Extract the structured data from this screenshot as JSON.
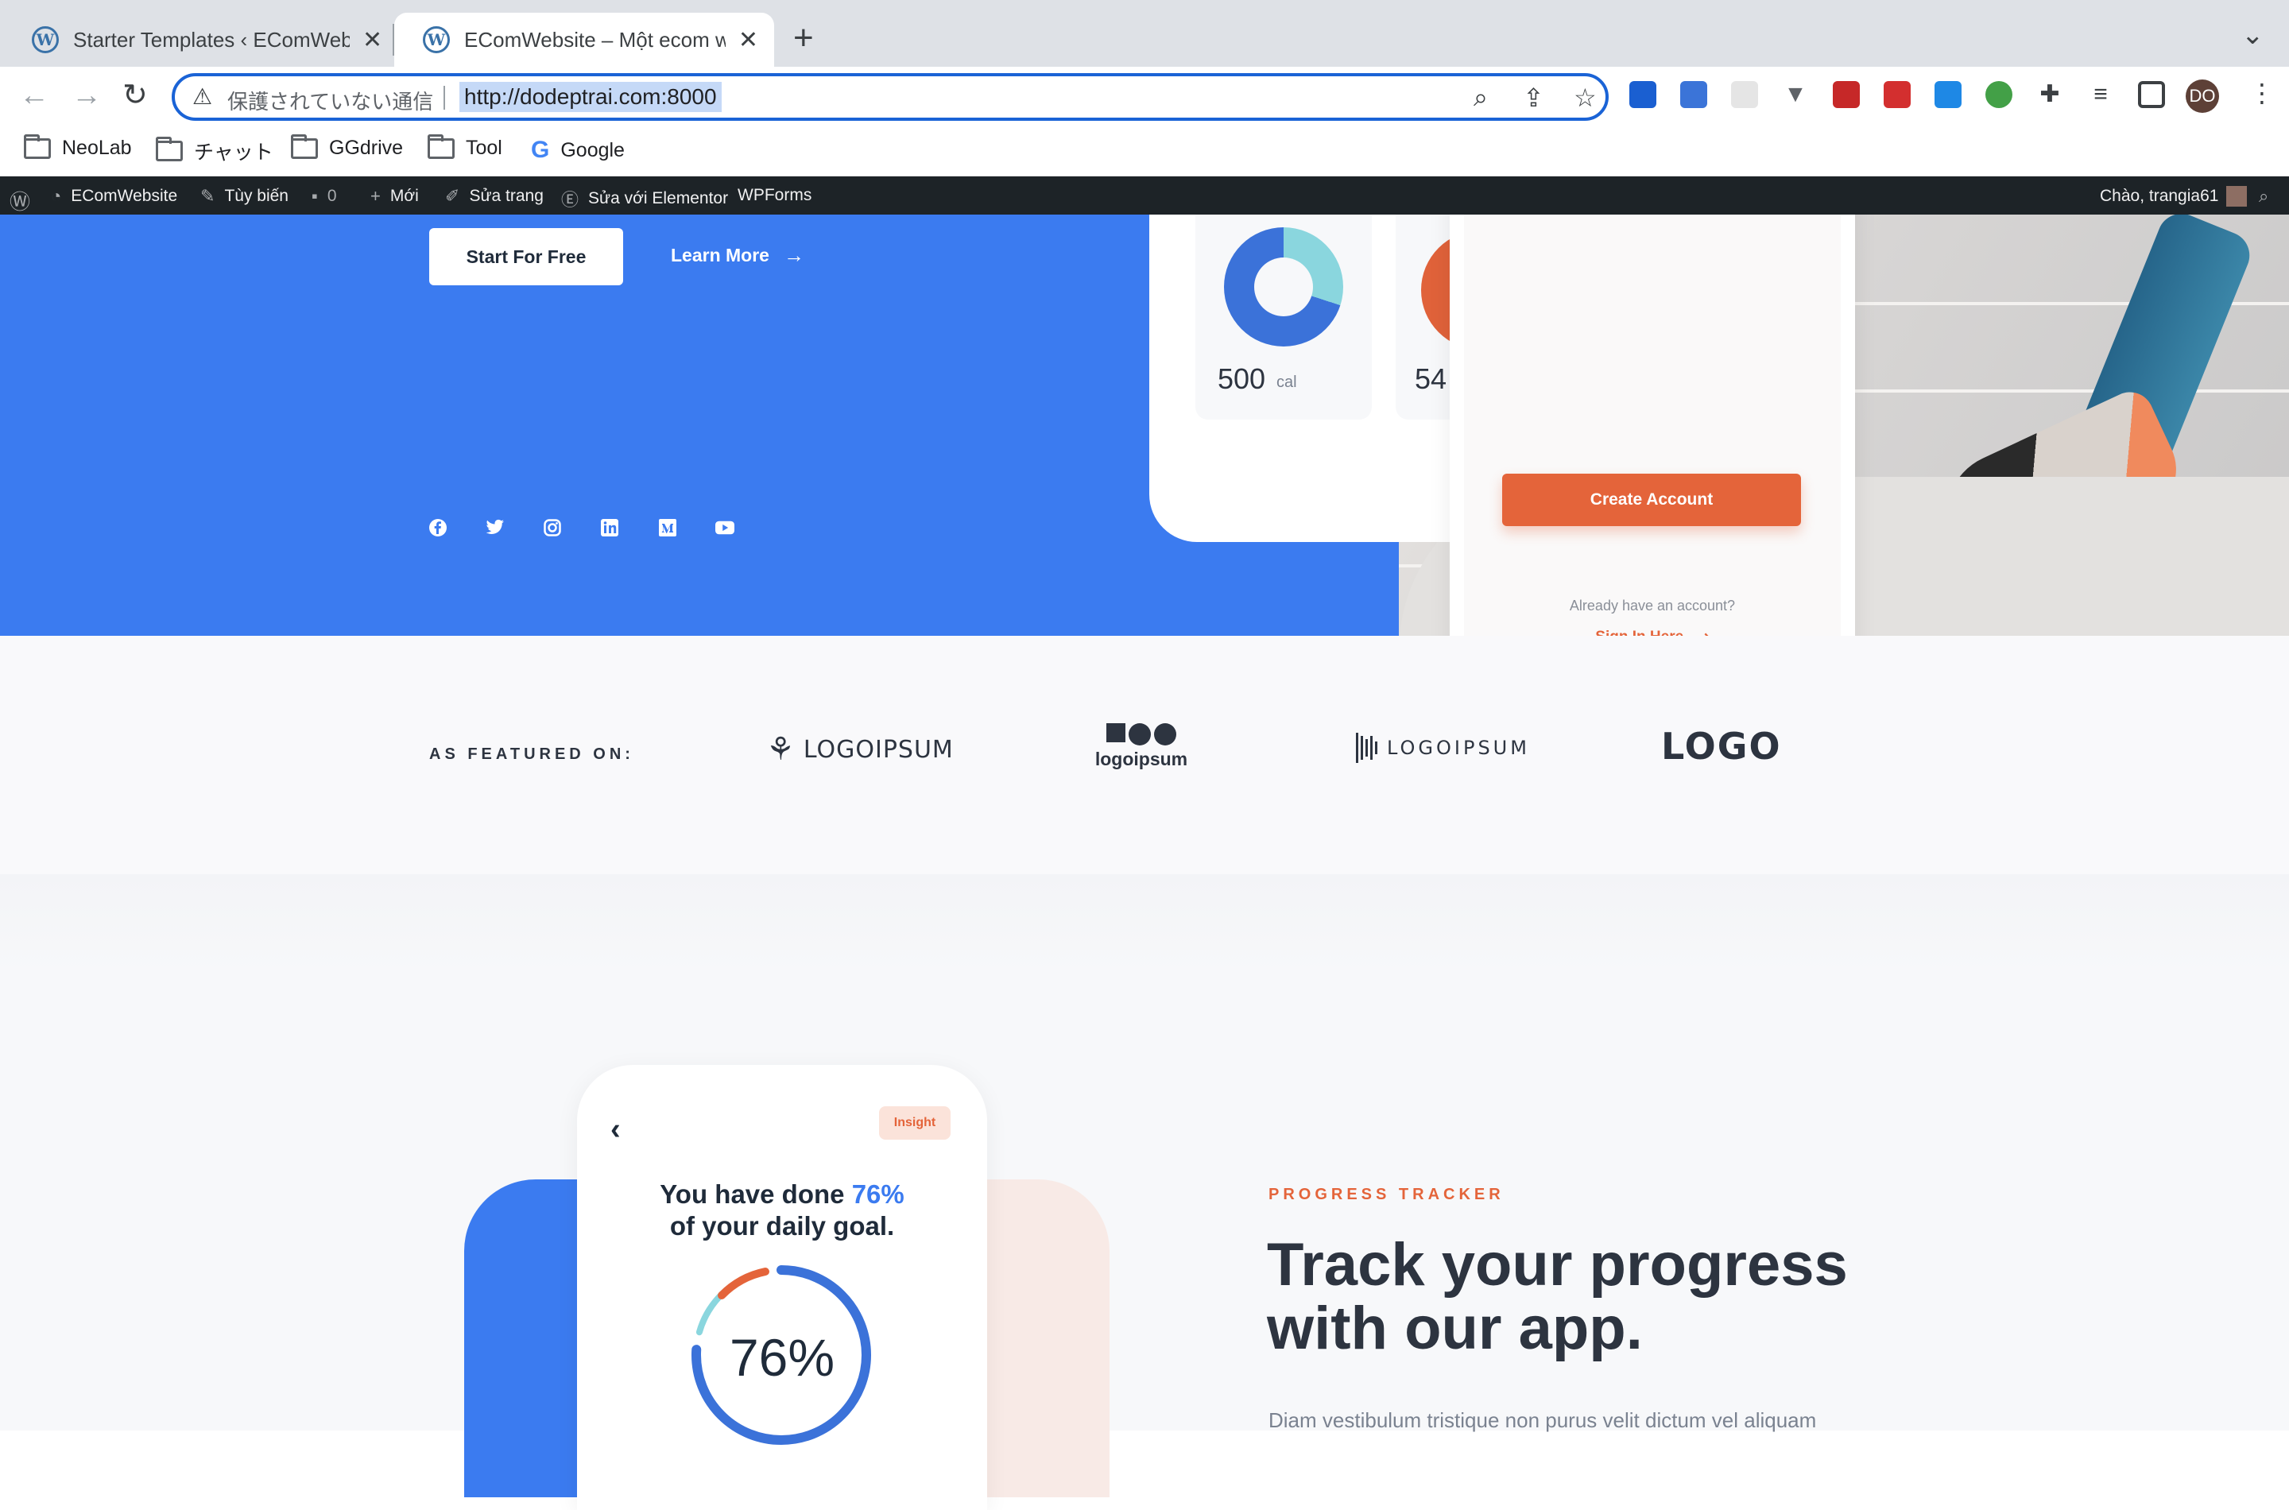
{
  "browser": {
    "tabs": [
      {
        "title": "Starter Templates ‹ EComWebsite",
        "active": false
      },
      {
        "title": "EComWebsite – Một ecom website",
        "active": true
      }
    ],
    "security_label": "保護されていない通信",
    "url": "http://dodeptrai.com:8000",
    "bookmarks": [
      "NeoLab",
      "チャット",
      "GGdrive",
      "Tool",
      "Google"
    ],
    "profile_initials": "DO"
  },
  "admin_bar": {
    "site_name": "EComWebsite",
    "customize": "Tùy biến",
    "comments_count": "0",
    "new": "Mới",
    "edit_page": "Sửa trang",
    "edit_elementor": "Sửa với Elementor",
    "wpforms": "WPForms",
    "greeting": "Chào, trangia61"
  },
  "hero": {
    "start_button": "Start For Free",
    "learn_more": "Learn More",
    "calorie_value": "500",
    "calorie_unit": "cal",
    "second_value": "54",
    "create_account": "Create Account",
    "already_account": "Already have an account?",
    "sign_in": "Sign In Here",
    "socials": [
      "facebook",
      "twitter",
      "instagram",
      "linkedin",
      "medium",
      "youtube"
    ]
  },
  "featured": {
    "label": "AS FEATURED ON:",
    "logos": [
      "LOGOIPSUM",
      "logoipsum",
      "LOGOIPSUM",
      "LOGO"
    ]
  },
  "progress": {
    "insight_badge": "Insight",
    "goal_prefix": "You have done ",
    "goal_percent": "76%",
    "goal_line2": "of your daily goal.",
    "ring_value": "76%",
    "ring_fraction": 0.76,
    "eyebrow": "PROGRESS TRACKER",
    "headline": "Track your progress with our app.",
    "body": "Diam vestibulum tristique non purus velit dictum vel aliquam"
  },
  "colors": {
    "brand_blue": "#3b7bf0",
    "accent_orange": "#e4643a",
    "dark_text": "#2d3440",
    "admin_bar": "#1d2327"
  }
}
